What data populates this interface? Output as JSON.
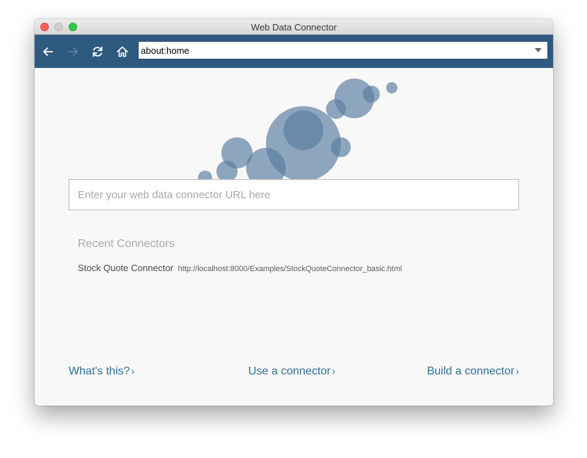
{
  "window": {
    "title": "Web Data Connector"
  },
  "toolbar": {
    "address_value": "about:home"
  },
  "main": {
    "url_placeholder": "Enter your web data connector URL here",
    "recent_heading": "Recent Connectors",
    "recent": [
      {
        "name": "Stock Quote Connector",
        "url": "http://localhost:8000/Examples/StockQuoteConnector_basic.html"
      }
    ]
  },
  "footer": {
    "whats_this": "What's this?",
    "use_connector": "Use a connector",
    "build_connector": "Build a connector",
    "chevron": "›"
  },
  "icons": {
    "back": "back-arrow-icon",
    "forward": "forward-arrow-icon",
    "reload": "reload-icon",
    "home": "home-icon",
    "dropdown": "chevron-down-icon"
  },
  "colors": {
    "toolbar": "#2f5a80",
    "bubble": "#5a7ea0",
    "link": "#2f6f96",
    "close": "#fc605b",
    "minimize": "#d0d0d0",
    "zoom": "#34c84a"
  }
}
